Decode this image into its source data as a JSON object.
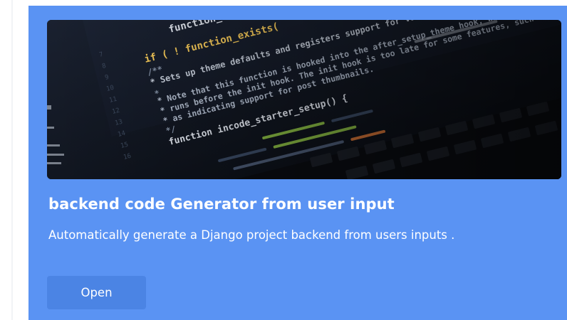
{
  "colors": {
    "page_background": "#ffffff",
    "card_background": "#5a93f3",
    "button_background": "#4b84e4",
    "text": "#ffffff"
  },
  "card": {
    "image": {
      "subject": "code editor on a laptop screen",
      "code_lines": [
        "function_exists(",
        "if ( ! function_exists(",
        "/**",
        " * Sets up theme defaults and registers support for various WordPress features.",
        " *",
        " * Note that this function is hooked into the after_setup_theme hook, which",
        " * runs before the init hook. The init hook is too late for some features, such",
        " * as indicating support for post thumbnails.",
        " */",
        "function incode_starter_setup() {"
      ]
    },
    "title": "backend code Generator from user input",
    "description": "Automatically generate a Django project backend from users inputs .",
    "button_label": "Open"
  }
}
